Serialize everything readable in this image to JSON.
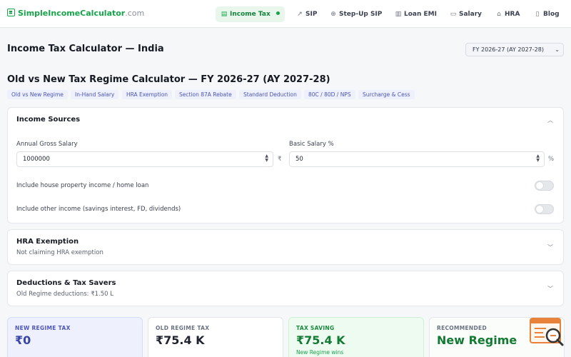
{
  "brand": {
    "name": "SimpleIncomeCalculator",
    "tld": ".com"
  },
  "nav": {
    "items": [
      {
        "label": "Income Tax",
        "icon": "document-icon"
      },
      {
        "label": "SIP",
        "icon": "trend-up-icon"
      },
      {
        "label": "Step-Up SIP",
        "icon": "circle-plus-icon"
      },
      {
        "label": "Loan EMI",
        "icon": "calculator-icon"
      },
      {
        "label": "Salary",
        "icon": "wallet-icon"
      },
      {
        "label": "HRA",
        "icon": "home-icon"
      },
      {
        "label": "Blog",
        "icon": "book-icon"
      }
    ]
  },
  "header": {
    "title": "Income Tax Calculator — India",
    "fy_selected": "FY 2026-27 (AY 2027-28)"
  },
  "subtitle": "Old vs New Tax Regime Calculator — FY 2026-27 (AY 2027-28)",
  "chips": [
    "Old vs New Regime",
    "In-Hand Salary",
    "HRA Exemption",
    "Section 87A Rebate",
    "Standard Deduction",
    "80C / 80D / NPS",
    "Surcharge & Cess"
  ],
  "income": {
    "title": "Income Sources",
    "gross_label": "Annual Gross Salary",
    "gross_value": "1000000",
    "gross_unit": "₹",
    "basic_label": "Basic Salary %",
    "basic_value": "50",
    "basic_unit": "%",
    "toggle_house": "Include house property income / home loan",
    "toggle_other": "Include other income (savings interest, FD, dividends)"
  },
  "hra": {
    "title": "HRA Exemption",
    "sub": "Not claiming HRA exemption"
  },
  "deductions": {
    "title": "Deductions & Tax Savers",
    "sub": "Old Regime deductions: ₹1.50 L"
  },
  "summary": {
    "new": {
      "label": "NEW REGIME TAX",
      "value": "₹0"
    },
    "old": {
      "label": "OLD REGIME TAX",
      "value": "₹75.4 K"
    },
    "saving": {
      "label": "TAX SAVING",
      "value": "₹75.4 K",
      "note": "New Regime wins"
    },
    "recommended": {
      "label": "RECOMMENDED",
      "value": "New Regime"
    }
  },
  "colors": {
    "accent": "#16a34a",
    "chip_text": "#4b56b8",
    "new_regime": "#3943a8"
  }
}
